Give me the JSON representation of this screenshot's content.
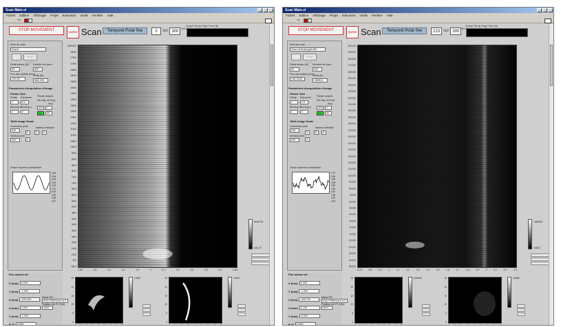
{
  "window_left": {
    "title": "Scan Main.vi",
    "menu": [
      "Fichier",
      "Edition",
      "Affichage",
      "Projet",
      "Exécution",
      "Outils",
      "Fenêtre",
      "Aide"
    ],
    "stop_label": "STOP MOVEMENT",
    "quit_label": "Quitter",
    "scan_title": "Scan",
    "mode": "Temporel Polar fixe",
    "counter": "0",
    "sur": "sur",
    "total": "300",
    "graph_title": "Graph Temp Dégl Fond (fi)",
    "graph_tick": "100,07",
    "params": {
      "nom_label": "Nom du scan",
      "nom_value": "Scan1",
      "btn_a": "",
      "btn_b": "STOP Scan",
      "delta_label": "Delta temps (fs)",
      "nombre_label": "Nombre de pas t",
      "delta_value": "30",
      "nombre_value": "300",
      "pos_label": "Pos abs platine (mm)",
      "delta2_label": "Delta (fs)",
      "pos_value": "100,46",
      "delta2_value": "486,336",
      "section_title": "Paramètres d'acquisition d'image",
      "param_cam": "Param Cam",
      "delay_label": "Delay",
      "exposure_label": "Exposure",
      "param_acq": "Param acquis",
      "delay_value": "1",
      "exposure_value": "0,5",
      "binning_x": "Binning x",
      "binning_y": "Binning y",
      "nb_img": "Nb img. nb img/",
      "moy": "moy",
      "bin_x_value": "1",
      "bin_y_value": "1",
      "acq_a": "300",
      "acq_b": "1",
      "inv_label": "inv",
      "acq_c": "50",
      "taille_title": "Taille image finale",
      "horiz_label": "Horizontal pixel",
      "ver_label": "Vertical pixel",
      "tableau_label": "tableau initialisé",
      "horiz_value": "344",
      "ver_value": "260",
      "t_a": "0",
      "t_b": "0",
      "t_c": "0",
      "t_d": "0",
      "graph_reponse": "Graph réponse photodiode",
      "sine_ticks": [
        "0,46",
        "0,45",
        "0,44",
        "0,43",
        "0,42",
        "0,41",
        "0,40",
        "0,39",
        "0,38",
        "0,37"
      ]
    },
    "motor": {
      "title": "Pos moteur all",
      "rows": [
        {
          "label": "X (mm)",
          "value": "3,000"
        },
        {
          "label": "Y (mm)",
          "value": "-1,000"
        },
        {
          "label": "Z (mm)",
          "value": "-400,000"
        },
        {
          "label": "U (mm)",
          "value": "2,000"
        },
        {
          "label": "V (mm)",
          "value": "-1,000"
        },
        {
          "label": "P (°)",
          "value": "0,000"
        },
        {
          "label": "A (°)",
          "value": "0,000"
        }
      ],
      "mode_pr_label": "Mode PR",
      "mode_pr_value": "Avec Référence à 0",
      "position_label": "Position de PI-0 (fs)",
      "position_value": "1000"
    },
    "main_yticks": [
      "160605,3",
      "18000",
      "17500",
      "17000",
      "16500",
      "16000",
      "15500",
      "15000",
      "14500",
      "14000",
      "13500",
      "13000",
      "12500",
      "12000",
      "11500",
      "11000",
      "10500",
      "10000",
      "9500",
      "9000",
      "8500",
      "8000",
      "7500",
      "7000",
      "6500",
      "6000",
      "5500",
      "5000",
      "4500",
      "4000",
      "3500",
      "3000",
      "2500",
      "2000",
      "1500",
      "1000",
      "500",
      "166,4"
    ],
    "main_xticks": [
      "1,80",
      "1,8",
      "1,9",
      "1,9",
      "1,9",
      "2",
      "2,1",
      "2,2",
      "2,2",
      "2,3",
      "2,3",
      "2,54"
    ],
    "cbar_top": "6540701",
    "cbar_bottom": "344,75",
    "bp1_cbar": "10607",
    "bp2_cbar": "10607",
    "bp_xticks": [
      "0",
      "10",
      "20",
      "30",
      "40",
      "50",
      "60",
      "70",
      "80"
    ],
    "bp_yticks": [
      "25",
      "20",
      "15",
      "10",
      "5",
      "0"
    ]
  },
  "window_right": {
    "title": "Scan Main.vi",
    "menu": [
      "Fichier",
      "Edition",
      "Affichage",
      "Projet",
      "Exécution",
      "Outils",
      "Fenêtre",
      "Aide"
    ],
    "stop_label": "STOP MOVEMENT",
    "quit_label": "Quitter",
    "scan_title": "Scan",
    "mode": "Temporel Polar fixe",
    "counter": "213",
    "sur": "sur",
    "total": "300",
    "graph_title": "Graph Temp Dégl Fond (fi)",
    "graph_tick": "284,01",
    "params": {
      "nom_label": "Nom du scan",
      "nom_value": "Scan<hr3x4p1gs1406",
      "btn_a": "",
      "btn_b": "STOP Scan",
      "delta_label": "Delta temps (fs)",
      "nombre_label": "Nombre de pas t",
      "delta_value": "30",
      "nombre_value": "300",
      "pos_label": "Pos abs platine (mm)",
      "delta2_label": "Delta (fs)",
      "pos_value": "146,3638",
      "delta2_value": "-3665,6",
      "section_title": "Paramètres d'acquisition d'image",
      "param_cam": "Param Cam",
      "delay_label": "Delay",
      "exposure_label": "Exposure",
      "param_acq": "Param acquis",
      "delay_value": "1",
      "exposure_value": "0,5",
      "binning_x": "Binning x",
      "binning_y": "Binning y",
      "nb_img": "Nb img. nb img/",
      "moy": "moy",
      "bin_x_value": "1",
      "bin_y_value": "1",
      "acq_a": "300",
      "acq_b": "1",
      "inv_label": "inv",
      "acq_c": "50",
      "taille_title": "Taille image finale",
      "horiz_label": "Horizontal pixel",
      "ver_label": "Vertical pixel",
      "tableau_label": "tableau initialisé",
      "horiz_value": "344",
      "ver_value": "260",
      "t_a": "0",
      "t_b": "0",
      "t_c": "0",
      "t_d": "0",
      "graph_reponse": "Graph réponse photodiode",
      "sine_ticks": [
        "2,70",
        "2,65",
        "2,60",
        "2,55",
        "2,50",
        "2,45",
        "2,40",
        "2,35",
        "2,30",
        "2,25"
      ]
    },
    "motor": {
      "title": "Pos moteur all",
      "rows": [
        {
          "label": "X (mm)",
          "value": "3,000"
        },
        {
          "label": "Y (mm)",
          "value": "-1,000"
        },
        {
          "label": "Z (mm)",
          "value": "-400,700"
        },
        {
          "label": "U (mm)",
          "value": "0,140"
        },
        {
          "label": "V (mm)",
          "value": "-0,500"
        },
        {
          "label": "P (°)",
          "value": "0,000"
        },
        {
          "label": "A (°)",
          "value": "0,000"
        }
      ],
      "mode_pr_label": "Mode PR",
      "mode_pr_value": "Avec Référence à 0",
      "position_label": "Position de PI-0 (fs)",
      "position_value": "3500"
    },
    "main_yticks": [
      "300,000",
      "290,000",
      "280,000",
      "270,000",
      "260,000",
      "250,000",
      "240,000",
      "230,000",
      "220,000",
      "210,000",
      "200,000",
      "190,000",
      "180,000",
      "170,000",
      "160,000",
      "150,000",
      "140,000",
      "130,000",
      "120,000",
      "110,000",
      "100,000",
      "90,000",
      "80,000",
      "70,000",
      "60,000",
      "50,000",
      "40,000",
      "30,000",
      "20,000",
      "10,000",
      "-10,000",
      "-20,000",
      "-30,000",
      "-40,000",
      "-50,000"
    ],
    "main_xticks": [
      "0,74",
      "0,8",
      "0,9",
      "1",
      "1,1",
      "1,2",
      "1,3",
      "1,4",
      "1,5",
      "1,6",
      "1,7",
      "1,8",
      "1,9",
      "2",
      "2,1",
      "2,2",
      "2,3"
    ],
    "cbar_top": "1463837",
    "cbar_bottom": "10823",
    "bp1_cbar": "225530",
    "bp2_cbar": "26986",
    "bp_xticks": [
      "0",
      "10",
      "20",
      "30",
      "40",
      "50",
      "60",
      "70",
      "80"
    ],
    "bp_yticks": [
      "25",
      "20",
      "15",
      "10",
      "5",
      "0"
    ]
  }
}
